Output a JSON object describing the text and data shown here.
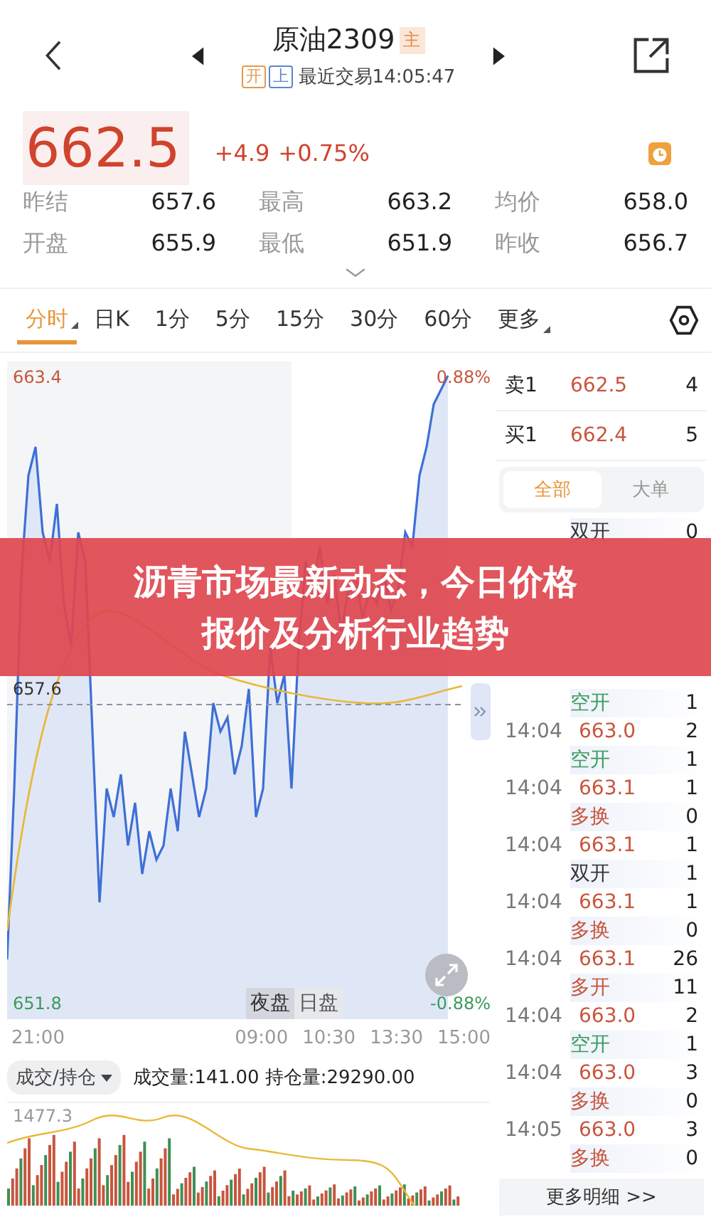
{
  "header": {
    "title": "原油2309",
    "title_badge": "主",
    "status_badges": [
      {
        "label": "开",
        "color": "#e39a4f"
      },
      {
        "label": "上",
        "color": "#5b87c9"
      }
    ],
    "last_trade": "最近交易14:05:47"
  },
  "quote": {
    "price": "662.5",
    "change": "+4.9",
    "change_pct": "+0.75%"
  },
  "stats": [
    {
      "label": "昨结",
      "value": "657.6"
    },
    {
      "label": "最高",
      "value": "663.2"
    },
    {
      "label": "均价",
      "value": "658.0"
    },
    {
      "label": "开盘",
      "value": "655.9"
    },
    {
      "label": "最低",
      "value": "651.9"
    },
    {
      "label": "昨收",
      "value": "656.7"
    }
  ],
  "tabs": [
    {
      "label": "分时",
      "selected": true,
      "dropdown": true
    },
    {
      "label": "日K",
      "selected": false,
      "dropdown": false
    },
    {
      "label": "1分",
      "selected": false,
      "dropdown": false
    },
    {
      "label": "5分",
      "selected": false,
      "dropdown": false
    },
    {
      "label": "15分",
      "selected": false,
      "dropdown": false
    },
    {
      "label": "30分",
      "selected": false,
      "dropdown": false
    },
    {
      "label": "60分",
      "selected": false,
      "dropdown": false
    },
    {
      "label": "更多",
      "selected": false,
      "dropdown": true
    }
  ],
  "chart": {
    "top_price": "663.4",
    "top_pct": "0.88%",
    "mid_price": "657.6",
    "bottom_price": "651.8",
    "bottom_pct": "-0.88%",
    "sessions": [
      {
        "label": "夜盘",
        "selected": true
      },
      {
        "label": "日盘",
        "selected": false
      }
    ],
    "time_labels": [
      "21:00",
      "09:00",
      "10:30",
      "13:30",
      "15:00"
    ]
  },
  "indicator": {
    "selector": "成交/持仓",
    "readout": "成交量:141.00 持仓量:29290.00",
    "volume_max": "1477.3"
  },
  "order_book": [
    {
      "side": "卖1",
      "price": "662.5",
      "volume": "4"
    },
    {
      "side": "买1",
      "price": "662.4",
      "volume": "5"
    }
  ],
  "trade_filter": [
    {
      "label": "全部",
      "selected": true
    },
    {
      "label": "大单",
      "selected": false
    }
  ],
  "trades": [
    {
      "type": "双开",
      "color": "#333333",
      "open_vol": "0"
    },
    {
      "type": "空开",
      "color": "#3a9a5c",
      "open_vol": "1"
    },
    {
      "time": "14:04",
      "price": "663.0",
      "volume": "2",
      "type": "空开",
      "color": "#3a9a5c",
      "open_vol": "1"
    },
    {
      "time": "14:04",
      "price": "663.1",
      "volume": "1",
      "type": "多换",
      "color": "#c8553d",
      "open_vol": "0"
    },
    {
      "time": "14:04",
      "price": "663.1",
      "volume": "1",
      "type": "双开",
      "color": "#333333",
      "open_vol": "1"
    },
    {
      "time": "14:04",
      "price": "663.1",
      "volume": "1",
      "type": "多换",
      "color": "#c8553d",
      "open_vol": "0"
    },
    {
      "time": "14:04",
      "price": "663.1",
      "volume": "26",
      "type": "多开",
      "color": "#c8553d",
      "open_vol": "11"
    },
    {
      "time": "14:04",
      "price": "663.0",
      "volume": "2",
      "type": "空开",
      "color": "#3a9a5c",
      "open_vol": "1"
    },
    {
      "time": "14:04",
      "price": "663.0",
      "volume": "3",
      "type": "多换",
      "color": "#c8553d",
      "open_vol": "0"
    },
    {
      "time": "14:05",
      "price": "663.0",
      "volume": "3",
      "type": "多换",
      "color": "#c8553d",
      "open_vol": "0"
    }
  ],
  "more_button": "更多明细 >>",
  "banner": {
    "lines": [
      "沥青市场最新动态，今日价格",
      "报价及分析行业趋势"
    ]
  }
}
